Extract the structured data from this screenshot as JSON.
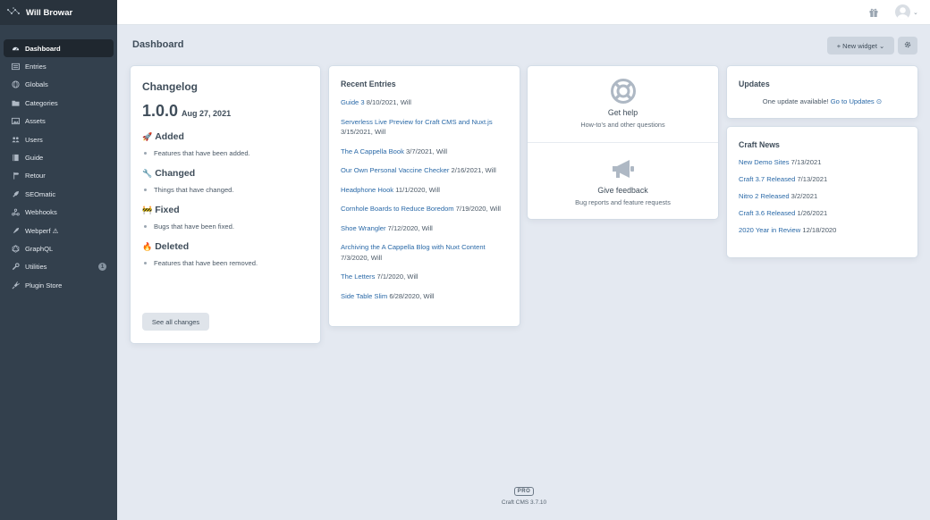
{
  "site": {
    "name": "Will Browar"
  },
  "nav": [
    {
      "label": "Dashboard",
      "icon": "gauge-icon",
      "selected": true
    },
    {
      "label": "Entries",
      "icon": "entries-icon"
    },
    {
      "label": "Globals",
      "icon": "globe-icon"
    },
    {
      "label": "Categories",
      "icon": "folder-icon"
    },
    {
      "label": "Assets",
      "icon": "image-icon"
    },
    {
      "label": "Users",
      "icon": "users-icon"
    },
    {
      "label": "Guide",
      "icon": "book-icon"
    },
    {
      "label": "Retour",
      "icon": "signpost-icon"
    },
    {
      "label": "SEOmatic",
      "icon": "seomatic-icon"
    },
    {
      "label": "Webhooks",
      "icon": "webhook-icon"
    },
    {
      "label": "Webperf ⚠",
      "icon": "rocket-icon"
    },
    {
      "label": "GraphQL",
      "icon": "graphql-icon"
    },
    {
      "label": "Utilities",
      "icon": "wrench-icon",
      "badge": "1"
    },
    {
      "label": "Plugin Store",
      "icon": "plug-icon"
    }
  ],
  "header": {
    "page_title": "Dashboard",
    "new_widget": "+ New widget ⌄"
  },
  "changelog": {
    "title": "Changelog",
    "version": "1.0.0",
    "date": "Aug 27, 2021",
    "sections": [
      {
        "emoji": "🚀",
        "title": "Added",
        "item": "Features that have been added."
      },
      {
        "emoji": "🔧",
        "title": "Changed",
        "item": "Things that have changed."
      },
      {
        "emoji": "🚧",
        "title": "Fixed",
        "item": "Bugs that have been fixed."
      },
      {
        "emoji": "🔥",
        "title": "Deleted",
        "item": "Features that have been removed."
      }
    ],
    "see_all": "See all changes"
  },
  "recent_entries": {
    "title": "Recent Entries",
    "items": [
      {
        "title": "Guide 3",
        "meta": " 8/10/2021, Will"
      },
      {
        "title": "Serverless Live Preview for Craft CMS and Nuxt.js",
        "meta": " 3/15/2021, Will"
      },
      {
        "title": "The A Cappella Book",
        "meta": " 3/7/2021, Will"
      },
      {
        "title": "Our Own Personal Vaccine Checker",
        "meta": " 2/16/2021, Will"
      },
      {
        "title": "Headphone Hook",
        "meta": " 11/1/2020, Will"
      },
      {
        "title": "Cornhole Boards to Reduce Boredom",
        "meta": " 7/19/2020, Will"
      },
      {
        "title": "Shoe Wrangler",
        "meta": " 7/12/2020, Will"
      },
      {
        "title": "Archiving the A Cappella Blog with Nuxt Content",
        "meta": " 7/3/2020, Will"
      },
      {
        "title": "The Letters",
        "meta": " 7/1/2020, Will"
      },
      {
        "title": "Side Table Slim",
        "meta": " 6/28/2020, Will"
      }
    ]
  },
  "help": {
    "help_title": "Get help",
    "help_sub": "How-to's and other questions",
    "feedback_title": "Give feedback",
    "feedback_sub": "Bug reports and feature requests"
  },
  "updates": {
    "title": "Updates",
    "text": "One update available! ",
    "link": "Go to Updates ⊙"
  },
  "news": {
    "title": "Craft News",
    "items": [
      {
        "title": "New Demo Sites",
        "date": " 7/13/2021"
      },
      {
        "title": "Craft 3.7 Released",
        "date": " 7/13/2021"
      },
      {
        "title": "Nitro 2 Released",
        "date": " 3/2/2021"
      },
      {
        "title": "Craft 3.6 Released",
        "date": " 1/26/2021"
      },
      {
        "title": "2020 Year in Review",
        "date": " 12/18/2020"
      }
    ]
  },
  "footer": {
    "edition": "PRO",
    "version": "Craft CMS 3.7.10"
  }
}
